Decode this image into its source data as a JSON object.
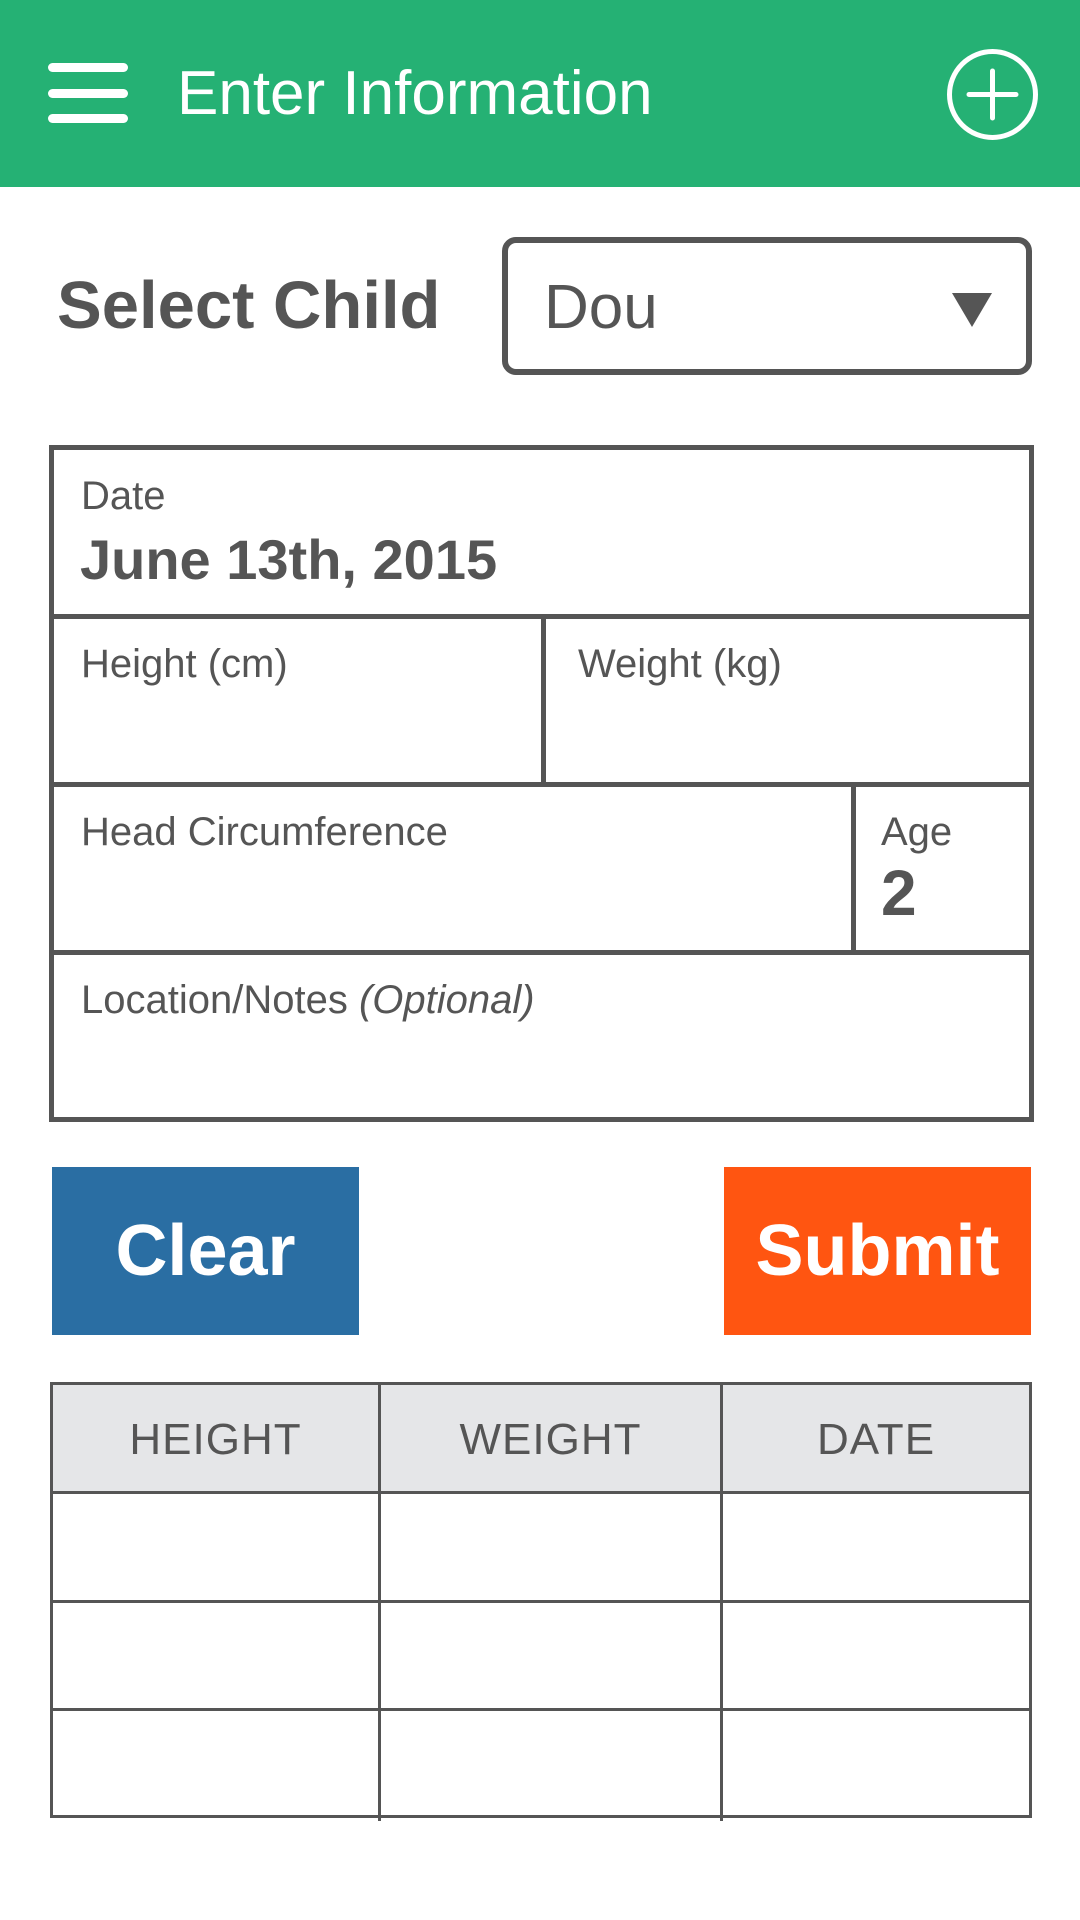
{
  "appbar": {
    "title": "Enter Information",
    "menu_icon": "hamburger-menu-icon",
    "add_icon": "add-circle-icon",
    "color": "#25b174"
  },
  "child_select": {
    "label": "Select Child",
    "selected": "Dou"
  },
  "form": {
    "date_label": "Date",
    "date_value": "June 13th, 2015",
    "height_label": "Height (cm)",
    "height_value": "",
    "weight_label": "Weight (kg)",
    "weight_value": "",
    "head_label": "Head Circumference",
    "head_value": "",
    "age_label": "Age",
    "age_value": "2",
    "notes_label": "Location/Notes",
    "notes_optional": "(Optional)",
    "notes_value": ""
  },
  "buttons": {
    "clear_label": "Clear",
    "submit_label": "Submit",
    "clear_color": "#2a6ea3",
    "submit_color": "#ff5511"
  },
  "table": {
    "columns": [
      "HEIGHT",
      "WEIGHT",
      "DATE"
    ],
    "rows": [
      [
        "",
        "",
        ""
      ],
      [
        "",
        "",
        ""
      ],
      [
        "",
        "",
        ""
      ]
    ]
  }
}
